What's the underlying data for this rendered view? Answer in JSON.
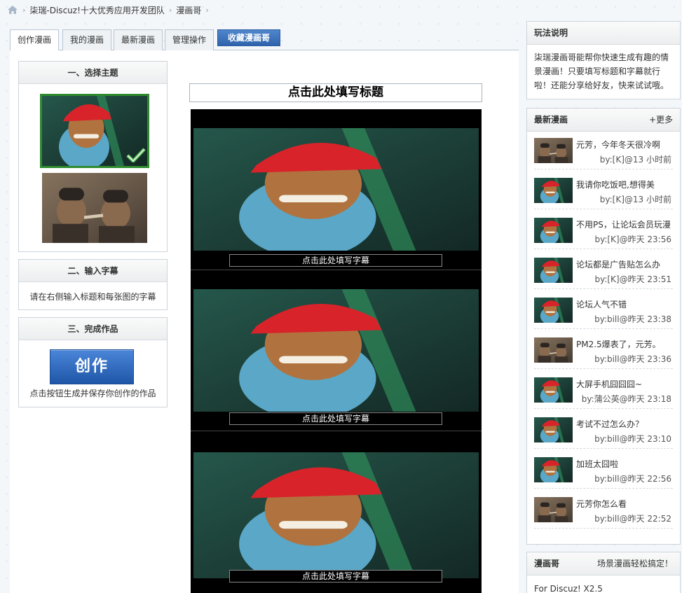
{
  "breadcrumb": {
    "items": [
      "柒瑞-Discuz!十大优秀应用开发团队",
      "漫画哥"
    ]
  },
  "tabs": [
    {
      "label": "创作漫画",
      "active": true
    },
    {
      "label": "我的漫画",
      "active": false
    },
    {
      "label": "最新漫画",
      "active": false
    },
    {
      "label": "管理操作",
      "active": false
    },
    {
      "label": "收藏漫画哥",
      "active": false
    }
  ],
  "steps": {
    "theme": {
      "title": "一、选择主题"
    },
    "caption": {
      "title": "二、输入字幕",
      "hint": "请在右侧输入标题和每张图的字幕"
    },
    "finish": {
      "title": "三、完成作品",
      "button": "创作",
      "hint": "点击按钮生成并保存你创作的作品"
    }
  },
  "comic": {
    "title_placeholder": "点击此处填写标题",
    "subtitles": [
      "点击此处填写字幕",
      "点击此处填写字幕",
      "点击此处填写字幕"
    ]
  },
  "sidebar": {
    "rules": {
      "title": "玩法说明",
      "text": "柒瑞漫画哥能帮你快速生成有趣的情景漫画！只要填写标题和字幕就行啦！还能分享给好友，快来试试哦。"
    },
    "latest": {
      "title": "最新漫画",
      "more": "+更多",
      "items": [
        {
          "title": "元芳，今年冬天很冷啊",
          "meta": "by:[K]@13 小时前",
          "theme": "b"
        },
        {
          "title": "我请你吃饭吧,想得美",
          "meta": "by:[K]@13 小时前",
          "theme": "a"
        },
        {
          "title": "不用PS，让论坛会员玩漫",
          "meta": "by:[K]@昨天 23:56",
          "theme": "a"
        },
        {
          "title": "论坛都是广告贴怎么办",
          "meta": "by:[K]@昨天 23:51",
          "theme": "a"
        },
        {
          "title": "论坛人气不错",
          "meta": "by:bill@昨天 23:38",
          "theme": "a"
        },
        {
          "title": "PM2.5爆表了，元芳。",
          "meta": "by:bill@昨天 23:36",
          "theme": "b"
        },
        {
          "title": "大屏手机囧囧囧~",
          "meta": "by:蒲公英@昨天 23:18",
          "theme": "a"
        },
        {
          "title": "考试不过怎么办？",
          "meta": "by:bill@昨天 23:10",
          "theme": "a"
        },
        {
          "title": "加班太囧啦",
          "meta": "by:bill@昨天 22:56",
          "theme": "a"
        },
        {
          "title": "元芳你怎么看",
          "meta": "by:bill@昨天 22:52",
          "theme": "b"
        }
      ]
    },
    "about": {
      "title": "漫画哥",
      "slogan": "场景漫画轻松搞定！",
      "text": "For Discuz! X2.5"
    }
  },
  "colors": {
    "selected_border": "#2e8b2e",
    "button_blue": "#2f64ad",
    "hat_red": "#d8232a"
  }
}
